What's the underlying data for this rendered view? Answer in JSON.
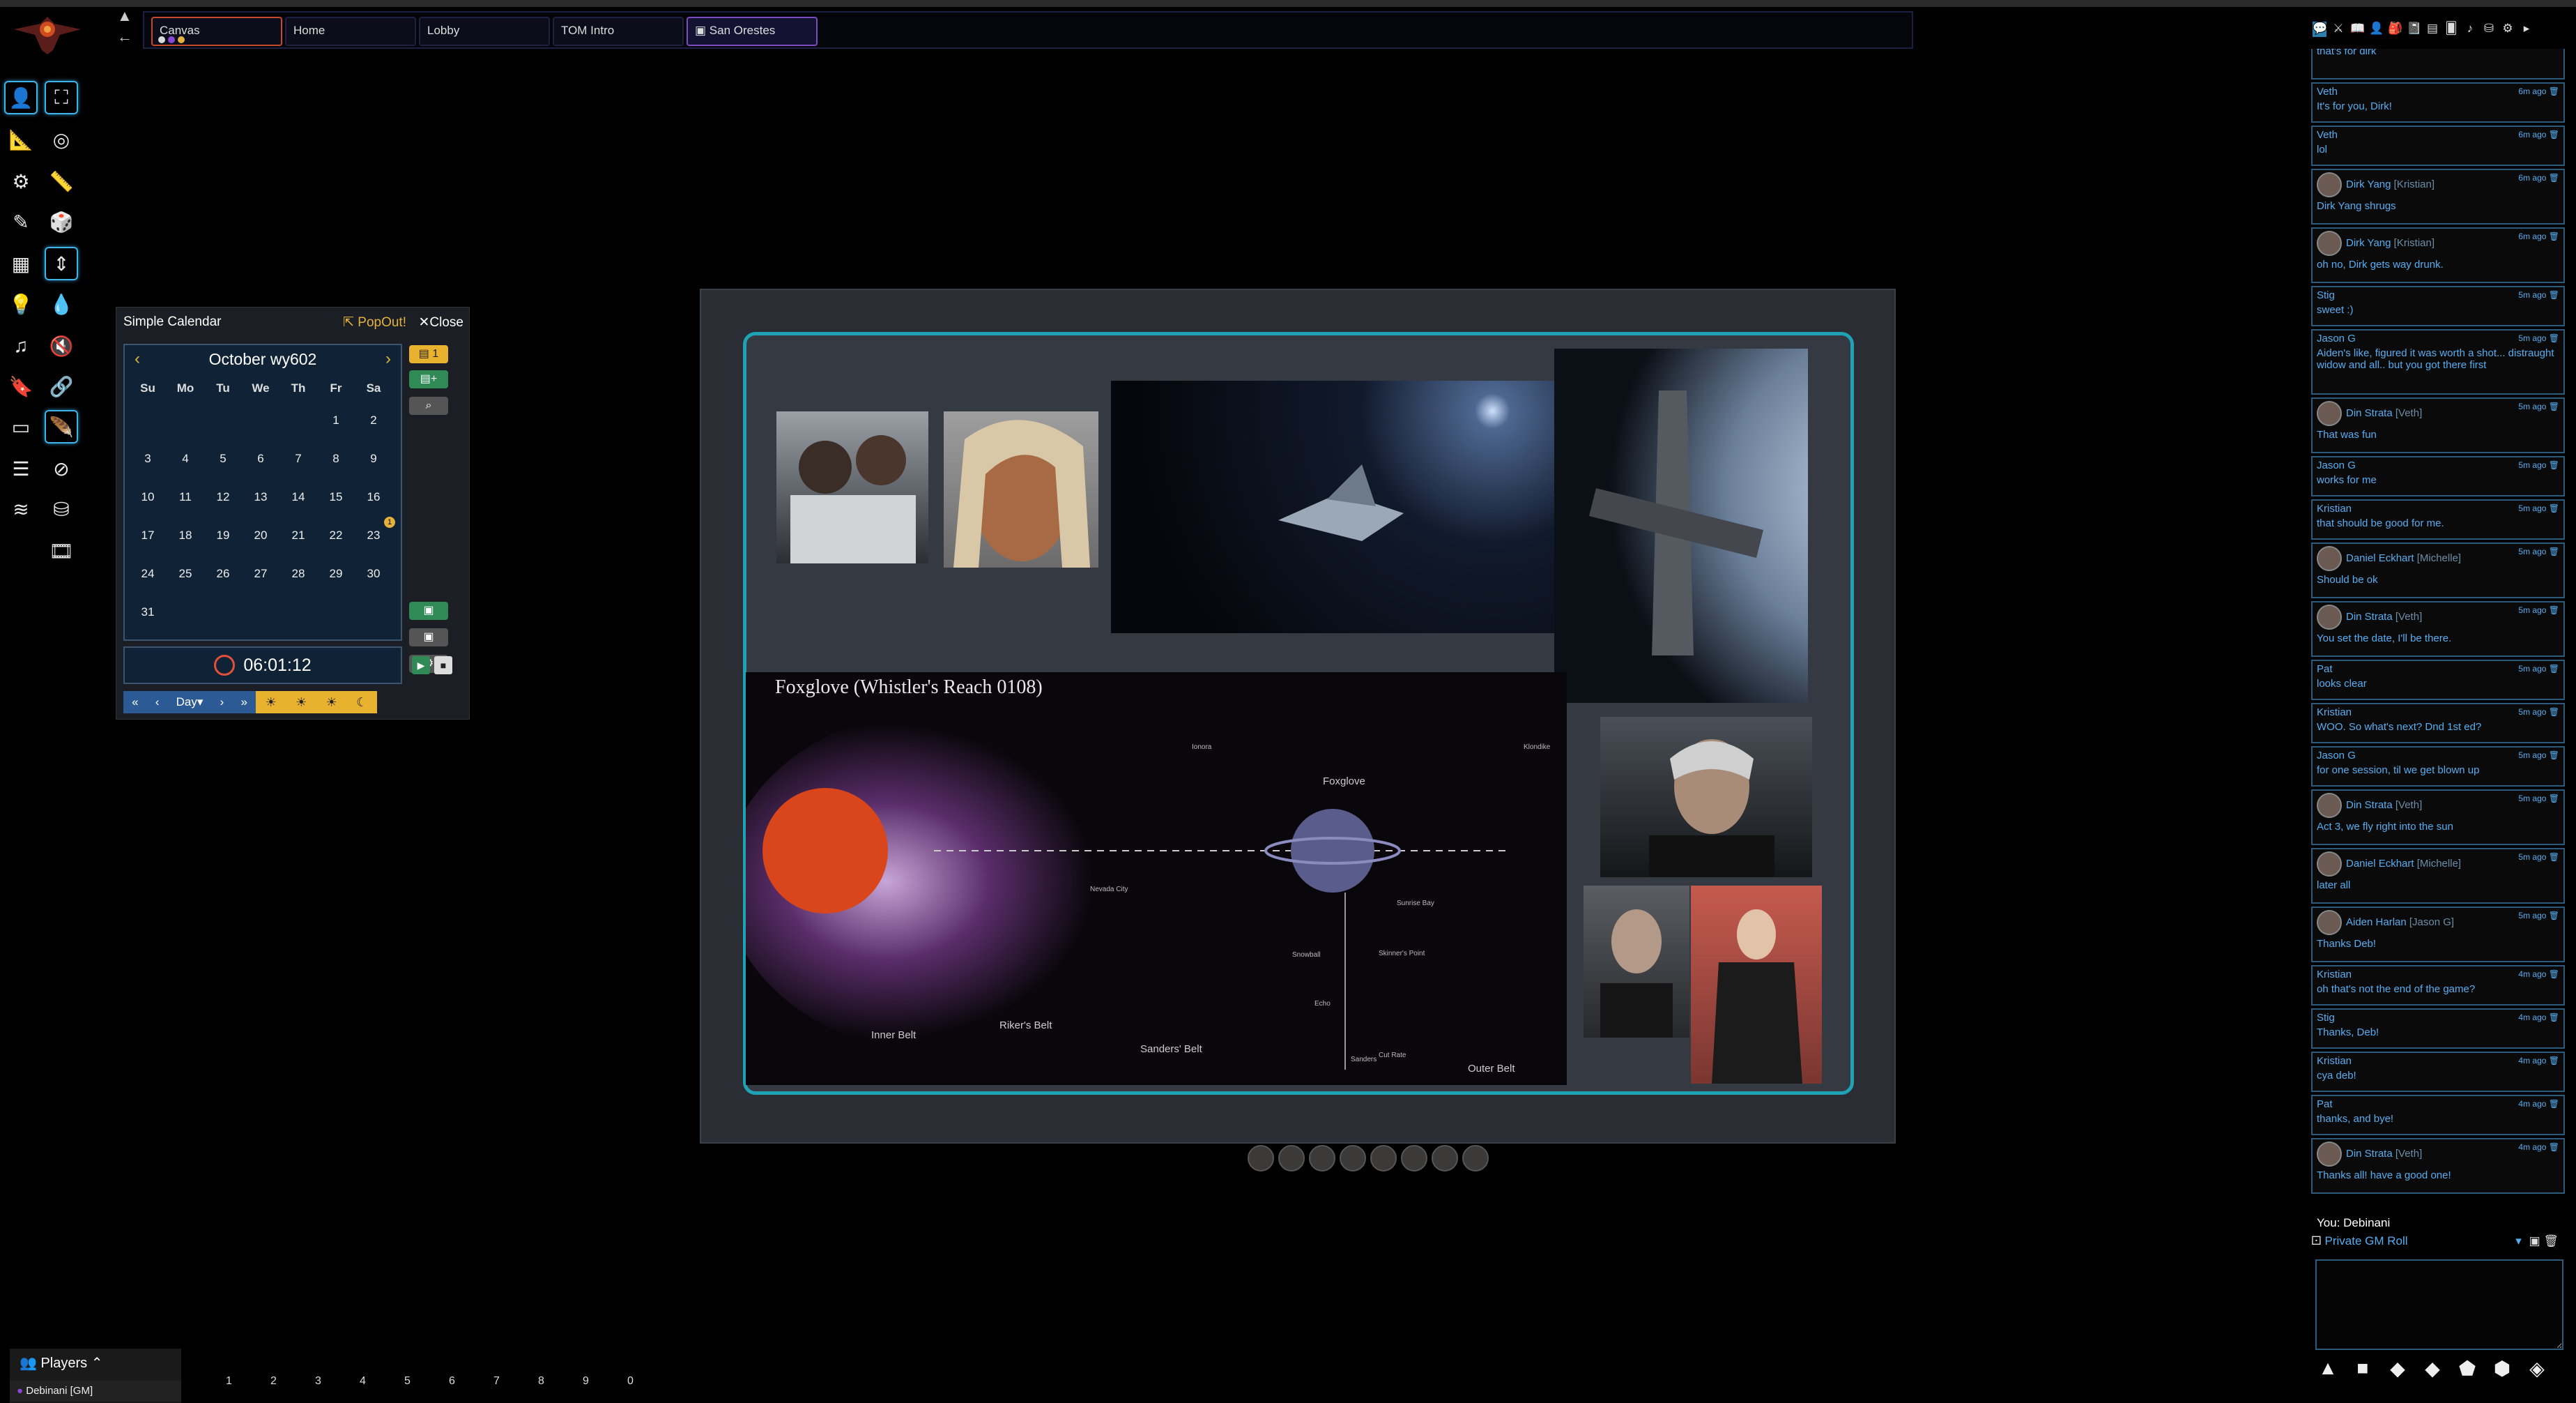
{
  "scene_nav": {
    "tabs": [
      {
        "label": "Canvas"
      },
      {
        "label": "Home"
      },
      {
        "label": "Lobby"
      },
      {
        "label": "TOM Intro"
      },
      {
        "label": "San Orestes"
      }
    ]
  },
  "left_tools": [
    "person-icon",
    "fullscreen-icon",
    "ruler-icon",
    "target-icon",
    "shapes-icon",
    "measure-icon",
    "pencil-icon",
    "dice-icon",
    "grid-icon",
    "chevron-updown-icon",
    "lightbulb-icon",
    "drop-icon",
    "music-icon",
    "mute-icon",
    "bookmark-icon",
    "link-icon",
    "window-icon",
    "feather-icon",
    "list-icon",
    "eye-slash-icon",
    "layers-icon",
    "database-icon",
    "film-icon"
  ],
  "calendar": {
    "title": "Simple Calendar",
    "popout_label": "PopOut!",
    "close_label": "Close",
    "month_label": "October wy602",
    "weekdays": [
      "Su",
      "Mo",
      "Tu",
      "We",
      "Th",
      "Fr",
      "Sa"
    ],
    "weeks": [
      [
        "",
        "",
        "",
        "",
        "",
        "1",
        "2"
      ],
      [
        "3",
        "4",
        "5",
        "6",
        "7",
        "8",
        "9"
      ],
      [
        "10",
        "11",
        "12",
        "13",
        "14",
        "15",
        "16"
      ],
      [
        "17",
        "18",
        "19",
        "20",
        "21",
        "22",
        "23"
      ],
      [
        "24",
        "25",
        "26",
        "27",
        "28",
        "29",
        "30"
      ],
      [
        "31",
        "",
        "",
        "",
        "",
        "",
        ""
      ]
    ],
    "note_badge": "1",
    "side_btn_note_count": "1",
    "time": "06:01:12",
    "time_unit": "Day"
  },
  "map": {
    "title": "Foxglove (Whistler's Reach 0108)",
    "labels": [
      "Inner Belt",
      "Riker's Belt",
      "Sanders' Belt",
      "Foxglove",
      "Outer Belt",
      "Sunrise Bay",
      "Snowball",
      "Echo",
      "Sanders",
      "Nevada City",
      "Ionora",
      "Klondike",
      "Skinner's Point",
      "Cut Rate"
    ]
  },
  "players": {
    "header": "Players",
    "gm": "Debinani [GM]"
  },
  "macro_slots": [
    "1",
    "2",
    "3",
    "4",
    "5",
    "6",
    "7",
    "8",
    "9",
    "0"
  ],
  "chat": {
    "messages": [
      {
        "who": "",
        "player": "",
        "time": "",
        "text": "that's for dirk",
        "avatar": false
      },
      {
        "who": "Veth",
        "player": "",
        "time": "6m ago",
        "text": "It's for you, Dirk!",
        "avatar": false
      },
      {
        "who": "Veth",
        "player": "",
        "time": "6m ago",
        "text": "lol",
        "avatar": false
      },
      {
        "who": "Dirk Yang",
        "player": "[Kristian]",
        "time": "6m ago",
        "text": "Dirk Yang shrugs",
        "avatar": true
      },
      {
        "who": "Dirk Yang",
        "player": "[Kristian]",
        "time": "6m ago",
        "text": "oh no, Dirk gets way drunk.",
        "avatar": true
      },
      {
        "who": "Stig",
        "player": "",
        "time": "5m ago",
        "text": "sweet :)",
        "avatar": false
      },
      {
        "who": "Jason G",
        "player": "",
        "time": "5m ago",
        "text": "Aiden's like, figured it was worth a shot... distraught widow and all.. but you got there first",
        "avatar": false
      },
      {
        "who": "Din Strata",
        "player": "[Veth]",
        "time": "5m ago",
        "text": "That was fun",
        "avatar": true
      },
      {
        "who": "Jason G",
        "player": "",
        "time": "5m ago",
        "text": "works for me",
        "avatar": false
      },
      {
        "who": "Kristian",
        "player": "",
        "time": "5m ago",
        "text": "that should be good for me.",
        "avatar": false
      },
      {
        "who": "Daniel Eckhart",
        "player": "[Michelle]",
        "time": "5m ago",
        "text": "Should be ok",
        "avatar": true
      },
      {
        "who": "Din Strata",
        "player": "[Veth]",
        "time": "5m ago",
        "text": "You set the date, I'll be there.",
        "avatar": true
      },
      {
        "who": "Pat",
        "player": "",
        "time": "5m ago",
        "text": "looks clear",
        "avatar": false
      },
      {
        "who": "Kristian",
        "player": "",
        "time": "5m ago",
        "text": "WOO. So what's next? Dnd 1st ed?",
        "avatar": false
      },
      {
        "who": "Jason G",
        "player": "",
        "time": "5m ago",
        "text": "for one session, til we get blown up",
        "avatar": false
      },
      {
        "who": "Din Strata",
        "player": "[Veth]",
        "time": "5m ago",
        "text": "Act 3, we fly right into the sun",
        "avatar": true
      },
      {
        "who": "Daniel Eckhart",
        "player": "[Michelle]",
        "time": "5m ago",
        "text": "later all",
        "avatar": true
      },
      {
        "who": "Aiden Harlan",
        "player": "[Jason G]",
        "time": "5m ago",
        "text": "Thanks Deb!",
        "avatar": true
      },
      {
        "who": "Kristian",
        "player": "",
        "time": "4m ago",
        "text": "oh that's not the end of the game?",
        "avatar": false
      },
      {
        "who": "Stig",
        "player": "",
        "time": "4m ago",
        "text": "Thanks, Deb!",
        "avatar": false
      },
      {
        "who": "Kristian",
        "player": "",
        "time": "4m ago",
        "text": "cya deb!",
        "avatar": false
      },
      {
        "who": "Pat",
        "player": "",
        "time": "4m ago",
        "text": "thanks, and bye!",
        "avatar": false
      },
      {
        "who": "Din Strata",
        "player": "[Veth]",
        "time": "4m ago",
        "text": "Thanks all! have a good one!",
        "avatar": true
      }
    ],
    "you_label": "You: Debinani",
    "roll_mode": "Private GM Roll",
    "input_value": ""
  },
  "colors": {
    "accent_cyan": "#1ea2b4",
    "chat_blue": "#55aef2",
    "gold": "#e3b23c",
    "active_tab_border": "#c54a2a",
    "current_scene_border": "#7a4cc0"
  }
}
